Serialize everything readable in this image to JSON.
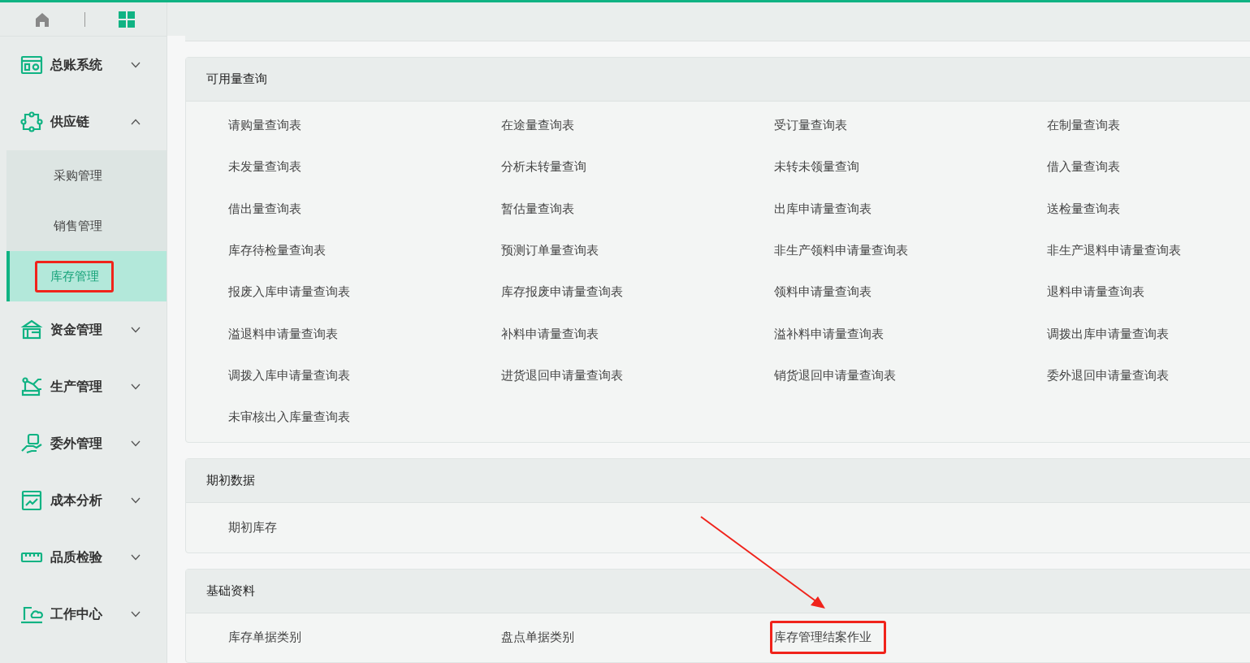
{
  "sidebar": {
    "items": [
      {
        "label": "总账系统",
        "expanded": false
      },
      {
        "label": "供应链",
        "expanded": true,
        "children": [
          {
            "label": "采购管理",
            "selected": false,
            "highlighted": false
          },
          {
            "label": "销售管理",
            "selected": false,
            "highlighted": false
          },
          {
            "label": "库存管理",
            "selected": true,
            "highlighted": true
          }
        ]
      },
      {
        "label": "资金管理",
        "expanded": false
      },
      {
        "label": "生产管理",
        "expanded": false
      },
      {
        "label": "委外管理",
        "expanded": false
      },
      {
        "label": "成本分析",
        "expanded": false
      },
      {
        "label": "品质检验",
        "expanded": false
      },
      {
        "label": "工作中心",
        "expanded": false
      }
    ]
  },
  "sections": [
    {
      "title": "可用量查询",
      "items": [
        {
          "label": "请购量查询表",
          "highlighted": false
        },
        {
          "label": "在途量查询表",
          "highlighted": false
        },
        {
          "label": "受订量查询表",
          "highlighted": false
        },
        {
          "label": "在制量查询表",
          "highlighted": false
        },
        {
          "label": "未发量查询表",
          "highlighted": false
        },
        {
          "label": "分析未转量查询",
          "highlighted": false
        },
        {
          "label": "未转未领量查询",
          "highlighted": false
        },
        {
          "label": "借入量查询表",
          "highlighted": false
        },
        {
          "label": "借出量查询表",
          "highlighted": false
        },
        {
          "label": "暂估量查询表",
          "highlighted": false
        },
        {
          "label": "出库申请量查询表",
          "highlighted": false
        },
        {
          "label": "送检量查询表",
          "highlighted": false
        },
        {
          "label": "库存待检量查询表",
          "highlighted": false
        },
        {
          "label": "预测订单量查询表",
          "highlighted": false
        },
        {
          "label": "非生产领料申请量查询表",
          "highlighted": false
        },
        {
          "label": "非生产退料申请量查询表",
          "highlighted": false
        },
        {
          "label": "报废入库申请量查询表",
          "highlighted": false
        },
        {
          "label": "库存报废申请量查询表",
          "highlighted": false
        },
        {
          "label": "领料申请量查询表",
          "highlighted": false
        },
        {
          "label": "退料申请量查询表",
          "highlighted": false
        },
        {
          "label": "溢退料申请量查询表",
          "highlighted": false
        },
        {
          "label": "补料申请量查询表",
          "highlighted": false
        },
        {
          "label": "溢补料申请量查询表",
          "highlighted": false
        },
        {
          "label": "调拨出库申请量查询表",
          "highlighted": false
        },
        {
          "label": "调拨入库申请量查询表",
          "highlighted": false
        },
        {
          "label": "进货退回申请量查询表",
          "highlighted": false
        },
        {
          "label": "销货退回申请量查询表",
          "highlighted": false
        },
        {
          "label": "委外退回申请量查询表",
          "highlighted": false
        },
        {
          "label": "未审核出入库量查询表",
          "highlighted": false
        }
      ]
    },
    {
      "title": "期初数据",
      "items": [
        {
          "label": "期初库存",
          "highlighted": false
        }
      ]
    },
    {
      "title": "基础资料",
      "items": [
        {
          "label": "库存单据类别",
          "highlighted": false
        },
        {
          "label": "盘点单据类别",
          "highlighted": false
        },
        {
          "label": "库存管理结案作业",
          "highlighted": true
        }
      ]
    }
  ]
}
